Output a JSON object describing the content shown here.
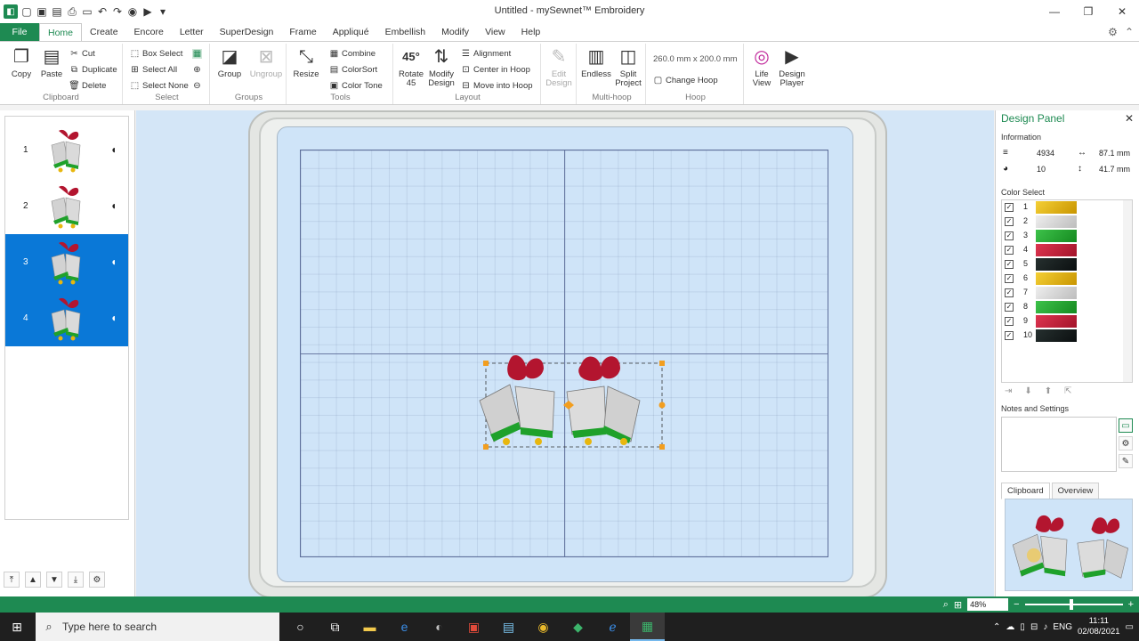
{
  "window": {
    "title": "Untitled - mySewnet™ Embroidery",
    "controls": [
      "—",
      "❐",
      "✕"
    ]
  },
  "tabs": [
    "File",
    "Home",
    "Create",
    "Encore",
    "Letter",
    "SuperDesign",
    "Frame",
    "Appliqué",
    "Embellish",
    "Modify",
    "View",
    "Help"
  ],
  "ribbon": {
    "clipboard": {
      "label": "Clipboard",
      "copy": "Copy",
      "paste": "Paste",
      "cut": "Cut",
      "duplicate": "Duplicate",
      "delete": "Delete"
    },
    "select": {
      "label": "Select",
      "box_select": "Box Select",
      "select_all": "Select All",
      "select_none": "Select None"
    },
    "groups": {
      "label": "Groups",
      "group": "Group",
      "ungroup": "Ungroup"
    },
    "tools": {
      "label": "Tools",
      "resize": "Resize",
      "combine": "Combine",
      "colorsort": "ColorSort",
      "color_tone": "Color Tone"
    },
    "layout": {
      "label": "Layout",
      "rotate_45": "Rotate 45",
      "modify_design": "Modify Design",
      "alignment": "Alignment",
      "center_in_hoop": "Center in Hoop",
      "move_into_hoop": "Move into Hoop",
      "rotate_icon_text": "45°"
    },
    "edit": {
      "edit_design": "Edit Design"
    },
    "multihoop": {
      "label": "Multi-hoop",
      "endless": "Endless",
      "split_project": "Split Project"
    },
    "hoop": {
      "label": "Hoop",
      "size": "260.0 mm x 200.0 mm",
      "change_hoop": "Change Hoop"
    },
    "view": {
      "life_view": "Life View",
      "design_player": "Design Player"
    }
  },
  "design_list": {
    "items": [
      {
        "num": "1",
        "selected": false
      },
      {
        "num": "2",
        "selected": false
      },
      {
        "num": "3",
        "selected": true
      },
      {
        "num": "4",
        "selected": true
      }
    ]
  },
  "design_panel": {
    "title": "Design Panel",
    "information_label": "Information",
    "stitches": "4934",
    "colors": "10",
    "width": "87.1 mm",
    "height": "41.7 mm",
    "color_select_label": "Color Select",
    "color_items": [
      {
        "num": "1",
        "color": "#e8b70e"
      },
      {
        "num": "2",
        "color": "#d6d6d6"
      },
      {
        "num": "3",
        "color": "#1fa12b"
      },
      {
        "num": "4",
        "color": "#c8203a"
      },
      {
        "num": "5",
        "color": "#121a1c"
      },
      {
        "num": "6",
        "color": "#e8b70e"
      },
      {
        "num": "7",
        "color": "#d6d6d6"
      },
      {
        "num": "8",
        "color": "#1fa12b"
      },
      {
        "num": "9",
        "color": "#c8203a"
      },
      {
        "num": "10",
        "color": "#121a1c"
      }
    ],
    "notes_label": "Notes and Settings",
    "tab_clipboard": "Clipboard",
    "tab_overview": "Overview"
  },
  "status": {
    "zoom": "48%"
  },
  "taskbar": {
    "search_placeholder": "Type here to search",
    "lang": "ENG",
    "time": "11:11",
    "date": "02/08/2021"
  },
  "colors": {
    "brand": "#1e8a52",
    "selection": "#0a78d7",
    "canvas": "#d4e6f7"
  }
}
